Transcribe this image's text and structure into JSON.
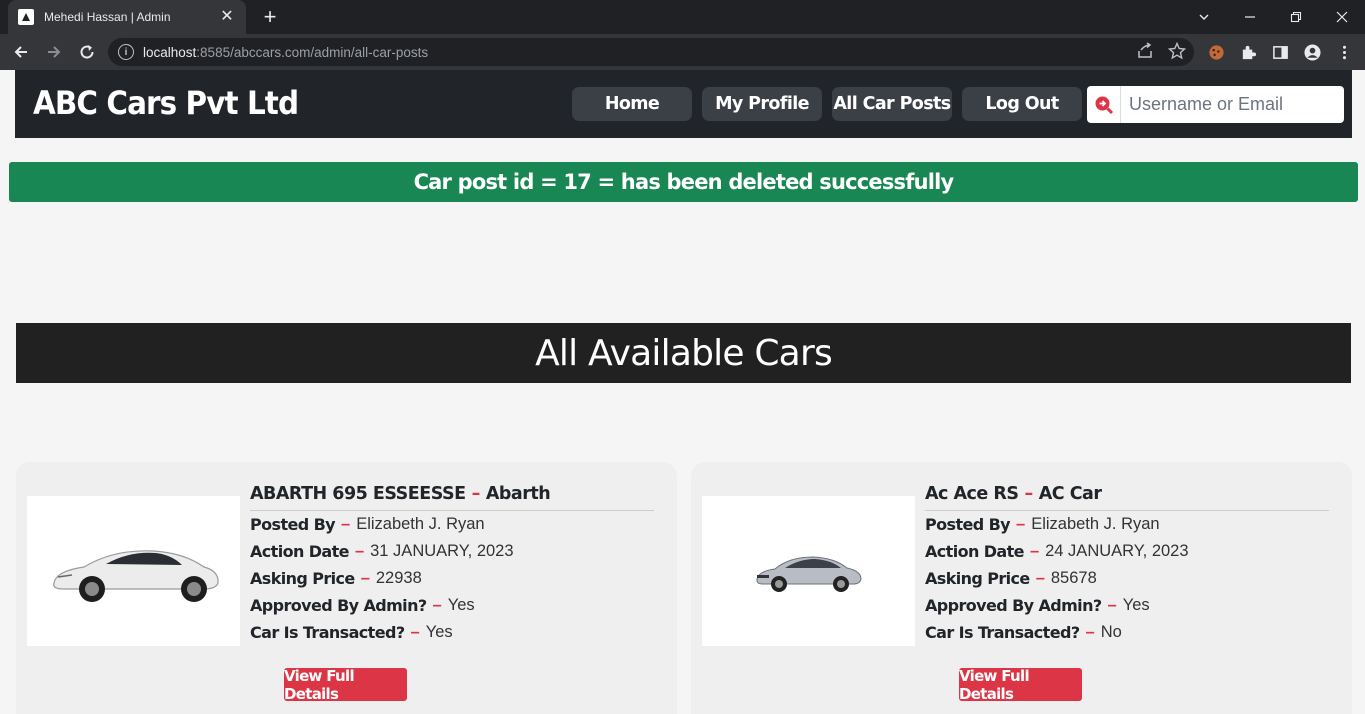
{
  "browser": {
    "tab_title": "Mehedi Hassan | Admin",
    "url_host": "localhost",
    "url_rest": ":8585/abccars.com/admin/all-car-posts"
  },
  "header": {
    "brand": "ABC Cars Pvt Ltd",
    "nav": [
      "Home",
      "My Profile",
      "All Car Posts",
      "Log Out"
    ],
    "search_placeholder": "Username or Email"
  },
  "alert": {
    "message": "Car post id = 17 = has been deleted successfully"
  },
  "section": {
    "title": "All Available Cars"
  },
  "labels": {
    "posted_by": "Posted By",
    "action_date": "Action Date",
    "asking_price": "Asking Price",
    "approved": "Approved By Admin?",
    "transacted": "Car Is Transacted?",
    "button": "View Full Details"
  },
  "cars": [
    {
      "model": "ABARTH 695 ESSEESSE",
      "make": "Abarth",
      "posted_by": "Elizabeth J. Ryan",
      "action_date": "31 JANUARY, 2023",
      "asking_price": "22938",
      "approved": "Yes",
      "transacted": "Yes",
      "car_color": "#e8e8e8"
    },
    {
      "model": "Ac Ace RS",
      "make": "AC Car",
      "posted_by": "Elizabeth J. Ryan",
      "action_date": "24 JANUARY, 2023",
      "asking_price": "85678",
      "approved": "Yes",
      "transacted": "No",
      "car_color": "#b8bcc4"
    }
  ],
  "colors": {
    "header_bg": "#212529",
    "alert_bg": "#198754",
    "accent_red": "#dc3545"
  }
}
